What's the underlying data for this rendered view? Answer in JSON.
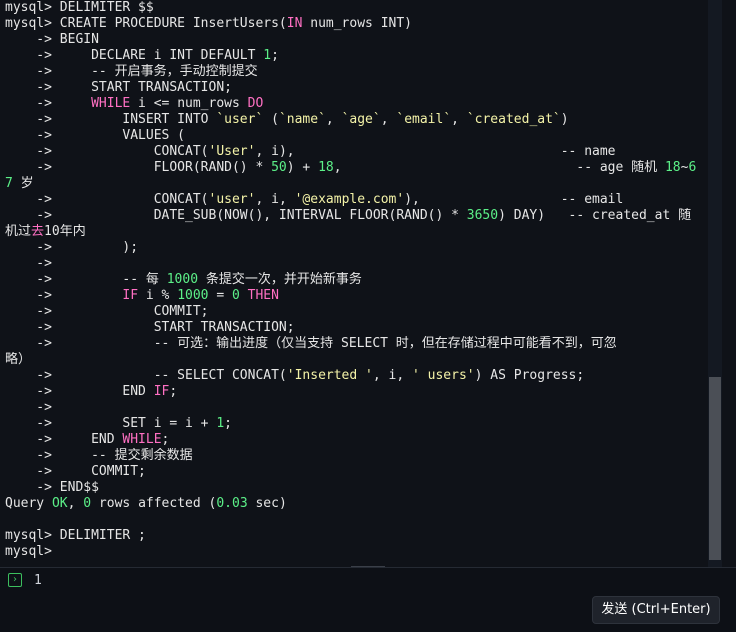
{
  "terminal": {
    "lines": [
      [
        {
          "t": "mysql> DELIMITER $$",
          "c": "plain"
        }
      ],
      [
        {
          "t": "mysql> CREATE PROCEDURE InsertUsers(",
          "c": "plain"
        },
        {
          "t": "IN",
          "c": "kw"
        },
        {
          "t": " num_rows INT)",
          "c": "plain"
        }
      ],
      [
        {
          "t": "    -> BEGIN",
          "c": "plain"
        }
      ],
      [
        {
          "t": "    ->     DECLARE i INT DEFAULT ",
          "c": "plain"
        },
        {
          "t": "1",
          "c": "num"
        },
        {
          "t": ";",
          "c": "plain"
        }
      ],
      [
        {
          "t": "    ->     -- 开启事务，手动控制提交",
          "c": "plain"
        }
      ],
      [
        {
          "t": "    ->     START TRANSACTION;",
          "c": "plain"
        }
      ],
      [
        {
          "t": "    ->     ",
          "c": "plain"
        },
        {
          "t": "WHILE",
          "c": "kw"
        },
        {
          "t": " i <= num_rows ",
          "c": "plain"
        },
        {
          "t": "DO",
          "c": "kw"
        }
      ],
      [
        {
          "t": "    ->         INSERT INTO ",
          "c": "plain"
        },
        {
          "t": "`user`",
          "c": "str"
        },
        {
          "t": " (",
          "c": "plain"
        },
        {
          "t": "`name`",
          "c": "str"
        },
        {
          "t": ", ",
          "c": "plain"
        },
        {
          "t": "`age`",
          "c": "str"
        },
        {
          "t": ", ",
          "c": "plain"
        },
        {
          "t": "`email`",
          "c": "str"
        },
        {
          "t": ", ",
          "c": "plain"
        },
        {
          "t": "`created_at`",
          "c": "str"
        },
        {
          "t": ")",
          "c": "plain"
        }
      ],
      [
        {
          "t": "    ->         VALUES (",
          "c": "plain"
        }
      ],
      [
        {
          "t": "    ->             CONCAT(",
          "c": "plain"
        },
        {
          "t": "'User'",
          "c": "str"
        },
        {
          "t": ", i),                                  -- name",
          "c": "plain"
        }
      ],
      [
        {
          "t": "    ->             FLOOR(RAND() * ",
          "c": "plain"
        },
        {
          "t": "50",
          "c": "num"
        },
        {
          "t": ") + ",
          "c": "plain"
        },
        {
          "t": "18",
          "c": "num"
        },
        {
          "t": ",                              -- age 随机 ",
          "c": "plain"
        },
        {
          "t": "18",
          "c": "num"
        },
        {
          "t": "~",
          "c": "plain"
        },
        {
          "t": "6",
          "c": "num"
        }
      ],
      [
        {
          "t": "7",
          "c": "num"
        },
        {
          "t": " 岁",
          "c": "plain"
        }
      ],
      [
        {
          "t": "    ->             CONCAT(",
          "c": "plain"
        },
        {
          "t": "'user'",
          "c": "str"
        },
        {
          "t": ", i, ",
          "c": "plain"
        },
        {
          "t": "'@example.com'",
          "c": "str"
        },
        {
          "t": "),                  -- email",
          "c": "plain"
        }
      ],
      [
        {
          "t": "    ->             DATE_SUB(NOW(), INTERVAL FLOOR(RAND() * ",
          "c": "plain"
        },
        {
          "t": "3650",
          "c": "num"
        },
        {
          "t": ") DAY)   -- created_at 随",
          "c": "plain"
        }
      ],
      [
        {
          "t": "机过",
          "c": "plain"
        },
        {
          "t": "去",
          "c": "kw"
        },
        {
          "t": "10",
          "c": "plain"
        },
        {
          "t": "年内",
          "c": "plain"
        }
      ],
      [
        {
          "t": "    ->         );",
          "c": "plain"
        }
      ],
      [
        {
          "t": "    ->",
          "c": "plain"
        }
      ],
      [
        {
          "t": "    ->         -- 每 ",
          "c": "plain"
        },
        {
          "t": "1000",
          "c": "num"
        },
        {
          "t": " 条提交一次，并开始新事务",
          "c": "plain"
        }
      ],
      [
        {
          "t": "    ->         ",
          "c": "plain"
        },
        {
          "t": "IF",
          "c": "kw"
        },
        {
          "t": " i % ",
          "c": "plain"
        },
        {
          "t": "1000",
          "c": "num"
        },
        {
          "t": " = ",
          "c": "plain"
        },
        {
          "t": "0",
          "c": "num"
        },
        {
          "t": " ",
          "c": "plain"
        },
        {
          "t": "THEN",
          "c": "kw"
        }
      ],
      [
        {
          "t": "    ->             COMMIT;",
          "c": "plain"
        }
      ],
      [
        {
          "t": "    ->             START TRANSACTION;",
          "c": "plain"
        }
      ],
      [
        {
          "t": "    ->             -- 可选：输出进度（仅当支持 SELECT 时，但在存储过程中可能看不到，可忽",
          "c": "plain"
        }
      ],
      [
        {
          "t": "略）",
          "c": "plain"
        }
      ],
      [
        {
          "t": "    ->             -- SELECT CONCAT(",
          "c": "plain"
        },
        {
          "t": "'Inserted '",
          "c": "str"
        },
        {
          "t": ", i, ",
          "c": "plain"
        },
        {
          "t": "' users'",
          "c": "str"
        },
        {
          "t": ") AS Progress;",
          "c": "plain"
        }
      ],
      [
        {
          "t": "    ->         END ",
          "c": "plain"
        },
        {
          "t": "IF",
          "c": "kw"
        },
        {
          "t": ";",
          "c": "plain"
        }
      ],
      [
        {
          "t": "    ->",
          "c": "plain"
        }
      ],
      [
        {
          "t": "    ->         SET i = i + ",
          "c": "plain"
        },
        {
          "t": "1",
          "c": "num"
        },
        {
          "t": ";",
          "c": "plain"
        }
      ],
      [
        {
          "t": "    ->     END ",
          "c": "plain"
        },
        {
          "t": "WHILE",
          "c": "kw"
        },
        {
          "t": ";",
          "c": "plain"
        }
      ],
      [
        {
          "t": "    ->     -- 提交剩余数据",
          "c": "plain"
        }
      ],
      [
        {
          "t": "    ->     COMMIT;",
          "c": "plain"
        }
      ],
      [
        {
          "t": "    -> END$$",
          "c": "plain"
        }
      ],
      [
        {
          "t": "Query ",
          "c": "plain"
        },
        {
          "t": "OK",
          "c": "num"
        },
        {
          "t": ", ",
          "c": "plain"
        },
        {
          "t": "0",
          "c": "num"
        },
        {
          "t": " rows affected (",
          "c": "plain"
        },
        {
          "t": "0.03",
          "c": "num"
        },
        {
          "t": " sec)",
          "c": "plain"
        }
      ],
      [
        {
          "t": "",
          "c": "plain"
        }
      ],
      [
        {
          "t": "mysql> DELIMITER ;",
          "c": "plain"
        }
      ],
      [
        {
          "t": "mysql>",
          "c": "plain"
        }
      ]
    ]
  },
  "input": {
    "line_number": "1",
    "prompt_icon": "terminal-prompt-icon"
  },
  "send_button": {
    "label": "发送 (Ctrl+Enter)"
  },
  "colors": {
    "keyword": "#ff70c3",
    "string": "#f4f3a8",
    "number": "#5cf088",
    "text": "#e6e6e6",
    "background": "#0f1218",
    "prompt_icon": "#3cbf5e"
  }
}
